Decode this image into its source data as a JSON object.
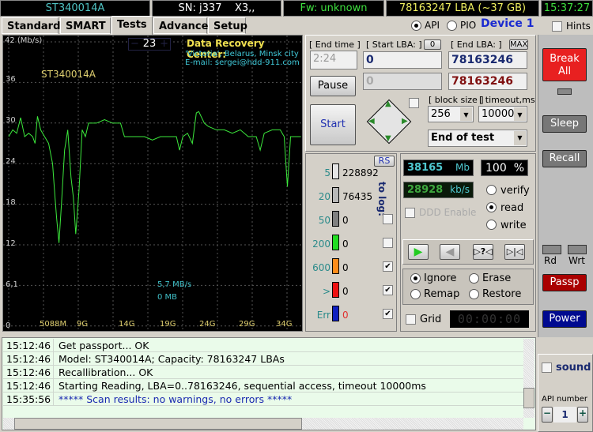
{
  "header": {
    "model": "ST340014A",
    "serial": "SN: j337",
    "extra": "X3,,",
    "firmware": "Fw: unknown",
    "capacity": "78163247 LBA (~37 GB)",
    "clock": "15:37:27"
  },
  "tabs": [
    {
      "label": "Standard"
    },
    {
      "label": "SMART"
    },
    {
      "label": "Tests",
      "active": true
    },
    {
      "label": "Advanced"
    },
    {
      "label": "Setup"
    }
  ],
  "mode": {
    "api": "API",
    "pio": "PIO",
    "selected": "API",
    "device": "Device 1",
    "hints": "Hints"
  },
  "graph": {
    "ylabel": "42 (Mb/s)",
    "yticks": [
      "36",
      "30",
      "24",
      "18",
      "12",
      "6,1",
      "0"
    ],
    "xticks": [
      "5088M",
      "9G",
      "14G",
      "19G",
      "24G",
      "29G",
      "34G"
    ],
    "spinner": "23",
    "drive": "ST340014A",
    "promo_title": "Data Recovery Center:",
    "promo_line1": "'Victoria', Belarus, Minsk city",
    "promo_line2": "E-mail: sergei@hdd-911.com",
    "speed": "5,7 MB/s",
    "mb": "0 MB",
    "line_color": "#3ce83c",
    "chart_data": {
      "type": "line",
      "ylim": [
        0,
        42
      ],
      "xlim_gb": [
        0,
        37
      ],
      "x": [
        0,
        0.5,
        1,
        1.5,
        2,
        2.5,
        3,
        3.3,
        3.6,
        4,
        4.5,
        5,
        5.5,
        5.8,
        6,
        6.3,
        6.6,
        7,
        7.4,
        7.8,
        8.1,
        8.4,
        8.8,
        9.2,
        9.6,
        10,
        11,
        12,
        13,
        14,
        14.5,
        15,
        16,
        17,
        18,
        19,
        20,
        21,
        21.4,
        21.8,
        22.4,
        23,
        23.5,
        23.8,
        24.5,
        25,
        26,
        27,
        28,
        29,
        30,
        31,
        31.5,
        32,
        33,
        34,
        34.5,
        34.9,
        35.3,
        36,
        36.6
      ],
      "y": [
        28,
        29,
        28.5,
        30.8,
        28,
        28.5,
        28,
        27,
        31,
        29,
        28,
        27,
        24,
        19,
        16,
        12.3,
        18,
        26,
        29,
        22,
        19,
        13.6,
        20,
        29,
        28,
        30,
        30,
        30.5,
        30,
        30,
        28,
        28,
        28,
        28,
        27.5,
        28,
        28,
        28,
        26,
        28,
        28.5,
        27,
        31.5,
        31.7,
        30,
        29.5,
        29,
        29,
        28.5,
        29,
        28,
        28,
        26,
        28.5,
        29,
        29,
        28,
        20.6,
        28,
        28,
        28
      ]
    }
  },
  "controls": {
    "end_time_label": "[ End time ]",
    "end_time": "2:24",
    "start_lba_label": "[ Start LBA: ]",
    "start_zero_btn": "0",
    "start_lba": "0",
    "start_lba2": "0",
    "end_lba_label": "[ End LBA: ]",
    "max_btn": "MAX",
    "end_lba": "78163246",
    "end_lba2": "78163246",
    "pause": "Pause",
    "start": "Start",
    "block_size_label": "[ block size ]",
    "block_size": "256",
    "timeout_label": "[ timeout,ms ]",
    "timeout": "10000",
    "end_action": "End of test"
  },
  "stats": {
    "rs": "RS",
    "to_log": "to log:",
    "rows": [
      {
        "threshold": "5",
        "count": "228892",
        "color": "#e4e4e4",
        "log": null
      },
      {
        "threshold": "20",
        "count": "76435",
        "color": "#b8b8b8",
        "log": null
      },
      {
        "threshold": "50",
        "count": "0",
        "color": "#808080",
        "log": false
      },
      {
        "threshold": "200",
        "count": "0",
        "color": "#22dd22",
        "log": false
      },
      {
        "threshold": "600",
        "count": "0",
        "color": "#ff8c1a",
        "log": true
      },
      {
        "threshold": ">",
        "count": "0",
        "color": "#ee1111",
        "log": true
      },
      {
        "threshold": "Err",
        "count": "0",
        "color": "#1020c0",
        "log": true
      }
    ]
  },
  "progress": {
    "mb": "38165",
    "mb_unit": "Mb",
    "percent": "100",
    "percent_unit": "%",
    "value_percent": 100,
    "rate": "28928",
    "rate_unit": "kb/s",
    "ddd": "DDD Enable",
    "verify": "verify",
    "read": "read",
    "write": "write",
    "mode": "read"
  },
  "actions": {
    "ignore": "Ignore",
    "erase": "Erase",
    "remap": "Remap",
    "restore": "Restore",
    "selected": "Ignore",
    "grid": "Grid",
    "timer": "00:00:00"
  },
  "side": {
    "break_all": "Break All",
    "sleep": "Sleep",
    "recall": "Recall",
    "rd": "Rd",
    "wrt": "Wrt",
    "passp": "Passp",
    "power": "Power",
    "sound": "sound",
    "api_number_label": "API number",
    "api_number": "1",
    "minus": "−",
    "plus": "+"
  },
  "log": [
    {
      "time": "15:12:46",
      "msg": "Get passport... OK"
    },
    {
      "time": "15:12:46",
      "msg": "Model: ST340014A; Capacity: 78163247 LBAs"
    },
    {
      "time": "15:12:46",
      "msg": "Recallibration... OK"
    },
    {
      "time": "15:12:46",
      "msg": "Starting Reading, LBA=0..78163246, sequential access, timeout 10000ms"
    },
    {
      "time": "15:35:56",
      "msg": "***** Scan results: no warnings, no errors *****",
      "highlight": true
    }
  ]
}
